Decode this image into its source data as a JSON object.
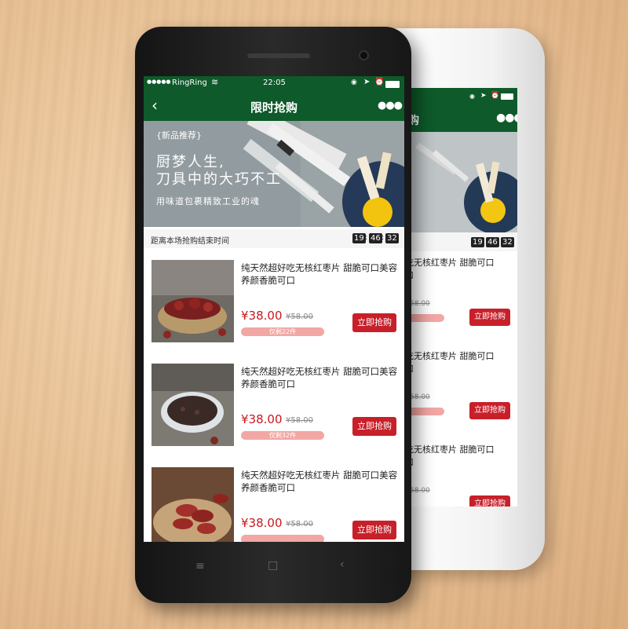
{
  "status": {
    "carrier": "RingRing",
    "time": "22:05"
  },
  "nav": {
    "title": "限时抢购"
  },
  "banner": {
    "tag": "{新品推荐}",
    "headline1": "厨梦人生,",
    "headline2": "刀具中的大巧不工",
    "subline": "用味道包裹精致工业的魂"
  },
  "countdown": {
    "label": "距离本场抢购结束时间",
    "hh": "19",
    "mm": "46",
    "ss": "32"
  },
  "products": [
    {
      "title": "纯天然超好吃无核红枣片 甜脆可口美容养颜香脆可口",
      "price": "¥38.00",
      "old_price": "¥58.00",
      "remain": "仅剩22件",
      "button": "立即抢购"
    },
    {
      "title": "纯天然超好吃无核红枣片 甜脆可口美容养颜香脆可口",
      "price": "¥38.00",
      "old_price": "¥58.00",
      "remain": "仅剩32件",
      "button": "立即抢购"
    },
    {
      "title": "纯天然超好吃无核红枣片 甜脆可口美容养颜香脆可口",
      "price": "¥38.00",
      "old_price": "¥58.00",
      "remain": "",
      "button": "立即抢购"
    }
  ],
  "back_phone": {
    "nav_title_partial": "购",
    "items": [
      {
        "title": "吃无核红枣片 甜脆可口",
        "title2": "口",
        "old_price": "58.00",
        "button": "立即抢购"
      },
      {
        "title": "吃无核红枣片 甜脆可口",
        "title2": "口",
        "old_price": "58.00",
        "button": "立即抢购"
      },
      {
        "title": "吃无核红枣片 甜脆可口",
        "title2": "口",
        "old_price": "58.00",
        "button": "立即抢购"
      }
    ]
  },
  "colors": {
    "brand_green": "#0e5a2a",
    "price_red": "#c8181e",
    "button_red": "#c8202a"
  }
}
